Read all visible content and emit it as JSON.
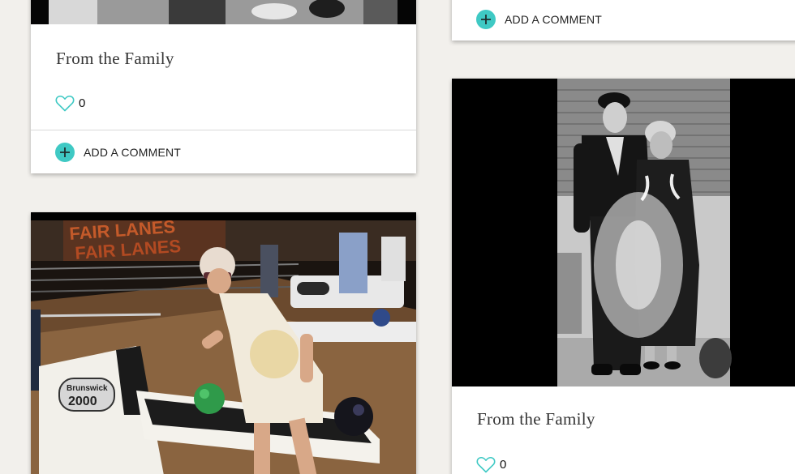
{
  "cards": {
    "top_left": {
      "title": "From the Family",
      "like_count": "0",
      "add_comment_label": "ADD A COMMENT"
    },
    "top_right": {
      "add_comment_label": "ADD A COMMENT"
    },
    "bottom_right": {
      "title": "From the Family",
      "like_count": "0"
    }
  },
  "icons": {
    "heart": "heart-outline-icon",
    "plus": "plus-circle-icon"
  },
  "colors": {
    "accent": "#3fc9c4",
    "page_background": "#f2f0ec",
    "card_background": "#ffffff"
  }
}
